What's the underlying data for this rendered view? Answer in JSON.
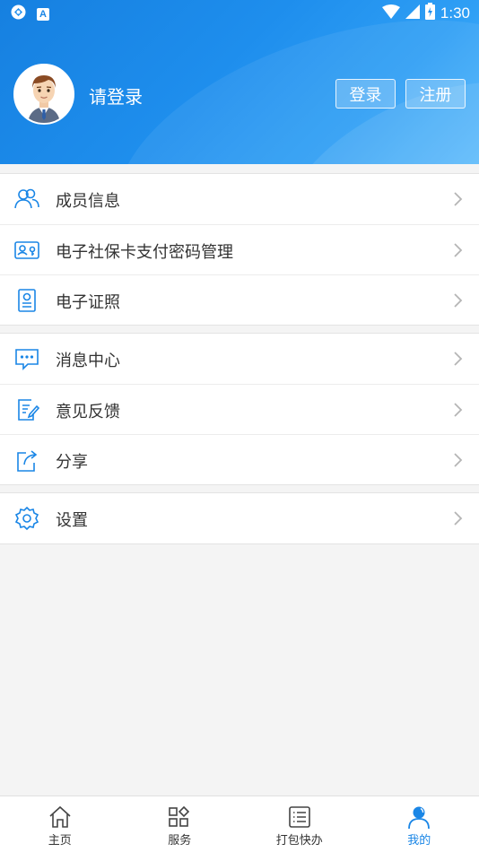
{
  "status_bar": {
    "time": "1:30",
    "notification_badge": "A"
  },
  "header": {
    "login_prompt": "请登录",
    "login_button": "登录",
    "register_button": "注册"
  },
  "menu_groups": [
    [
      {
        "label": "成员信息",
        "icon": "members-icon"
      },
      {
        "label": "电子社保卡支付密码管理",
        "icon": "social-card-icon"
      },
      {
        "label": "电子证照",
        "icon": "license-icon"
      }
    ],
    [
      {
        "label": "消息中心",
        "icon": "message-icon"
      },
      {
        "label": "意见反馈",
        "icon": "feedback-icon"
      },
      {
        "label": "分享",
        "icon": "share-icon"
      }
    ],
    [
      {
        "label": "设置",
        "icon": "settings-icon"
      }
    ]
  ],
  "tabbar": [
    {
      "label": "主页",
      "icon": "home-icon"
    },
    {
      "label": "服务",
      "icon": "services-icon"
    },
    {
      "label": "打包快办",
      "icon": "list-icon"
    },
    {
      "label": "我的",
      "icon": "profile-icon",
      "active": true
    }
  ],
  "colors": {
    "accent": "#1a86e6",
    "header_start": "#1680e0",
    "header_end": "#52b6fb"
  }
}
